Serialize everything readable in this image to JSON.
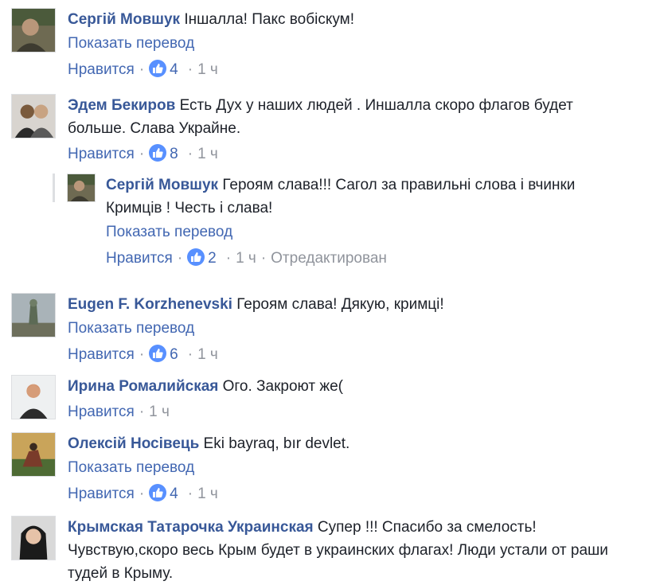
{
  "comments": [
    {
      "author": "Сергій Мовшук",
      "text": "Іншалла! Пакс вобіскум!",
      "translate": "Показать перевод",
      "like": "Нравится",
      "reactions": "4",
      "time": "1 ч"
    },
    {
      "author": "Эдем Бекиров",
      "text": "Есть Дух у наших людей . Иншалла скоро флагов будет больше. Слава Украйне.",
      "like": "Нравится",
      "reactions": "8",
      "time": "1 ч"
    },
    {
      "author": "Сергій Мовшук",
      "text": "Героям слава!!! Сагол за правильні слова і вчинки Кримців ! Честь і слава!",
      "translate": "Показать перевод",
      "like": "Нравится",
      "reactions": "2",
      "time": "1 ч",
      "edited": "Отредактирован"
    },
    {
      "author": "Eugen F. Korzhenevski",
      "text": "Героям слава! Дякую, кримці!",
      "translate": "Показать перевод",
      "like": "Нравится",
      "reactions": "6",
      "time": "1 ч"
    },
    {
      "author": "Ирина Ромалийская",
      "text": "Ого. Закроют же(",
      "like": "Нравится",
      "time": "1 ч"
    },
    {
      "author": "Олексій Носівець",
      "text": "Eki bayraq, bır devlet.",
      "translate": "Показать перевод",
      "like": "Нравится",
      "reactions": "4",
      "time": "1 ч"
    },
    {
      "author": "Крымская Татарочка Украинская",
      "text": "Супер !!! Спасибо за смелость! Чувствую,скоро весь Крым будет в украинских флагах! Люди устали от раши тудей в Крыму."
    }
  ],
  "icons": {
    "reaction": "thumbs-up-icon"
  },
  "colors": {
    "author": "#385898",
    "link": "#4267b2",
    "meta": "#90949c",
    "reaction": "#5890ff"
  }
}
